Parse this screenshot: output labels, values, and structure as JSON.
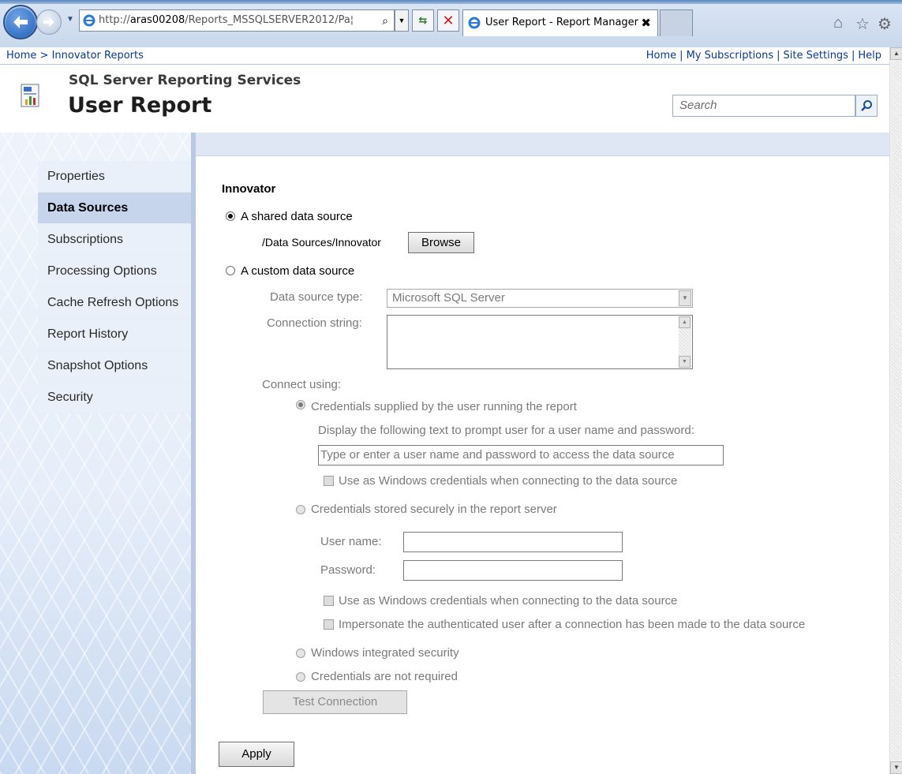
{
  "browser": {
    "url_prefix": "http://",
    "url_host": "aras00208",
    "url_rest": "/Reports_MSSQLSERVER2012/Pa¦",
    "tab_title": "User Report - Report Manager",
    "tab_close": "✖",
    "home_icon": "⌂",
    "star_icon": "☆",
    "gear_icon": "⚙"
  },
  "breadcrumb": {
    "home": "Home",
    "separator": ">",
    "current": "Innovator Reports"
  },
  "top_links": [
    "Home",
    "My Subscriptions",
    "Site Settings",
    "Help"
  ],
  "header": {
    "product": "SQL Server Reporting Services",
    "title": "User Report",
    "search_placeholder": "Search"
  },
  "sidebar": {
    "items": [
      {
        "label": "Properties",
        "active": false
      },
      {
        "label": "Data Sources",
        "active": true
      },
      {
        "label": "Subscriptions",
        "active": false
      },
      {
        "label": "Processing Options",
        "active": false
      },
      {
        "label": "Cache Refresh Options",
        "active": false
      },
      {
        "label": "Report History",
        "active": false
      },
      {
        "label": "Snapshot Options",
        "active": false
      },
      {
        "label": "Security",
        "active": false
      }
    ]
  },
  "form": {
    "section_title": "Innovator",
    "shared_label": "A shared data source",
    "shared_path": "/Data Sources/Innovator",
    "browse_label": "Browse",
    "custom_label": "A custom data source",
    "ds_type_label": "Data source type:",
    "ds_type_value": "Microsoft SQL Server",
    "conn_string_label": "Connection string:",
    "connect_using_label": "Connect using:",
    "cred_user_label": "Credentials supplied by the user running the report",
    "prompt_label": "Display the following text to prompt user for a user name and password:",
    "prompt_value": "Type or enter a user name and password to access the data source",
    "use_windows_1": "Use as Windows credentials when connecting to the data source",
    "cred_stored_label": "Credentials stored securely in the report server",
    "username_label": "User name:",
    "password_label": "Password:",
    "use_windows_2": "Use as Windows credentials when connecting to the data source",
    "impersonate_label": "Impersonate the authenticated user after a connection has been made to the data source",
    "windows_integrated_label": "Windows integrated security",
    "not_required_label": "Credentials are not required",
    "test_connection_label": "Test Connection",
    "apply_label": "Apply"
  }
}
